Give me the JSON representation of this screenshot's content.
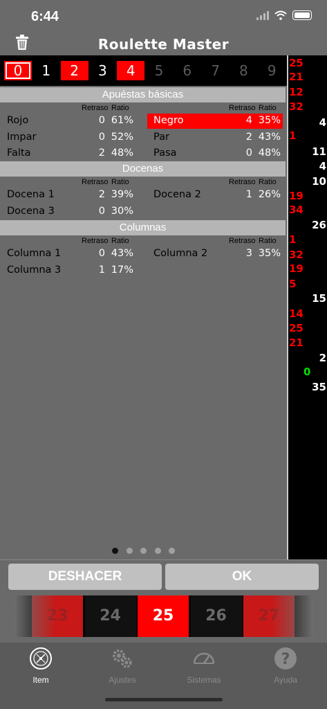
{
  "status": {
    "time": "6:44"
  },
  "header": {
    "title": "Roulette Master"
  },
  "strip": {
    "numbers": [
      {
        "n": "0",
        "style": "red-outline"
      },
      {
        "n": "1",
        "style": "white"
      },
      {
        "n": "2",
        "style": "red"
      },
      {
        "n": "3",
        "style": "white"
      },
      {
        "n": "4",
        "style": "red"
      },
      {
        "n": "5",
        "style": "dim"
      },
      {
        "n": "6",
        "style": "dim"
      },
      {
        "n": "7",
        "style": "dim"
      },
      {
        "n": "8",
        "style": "dim"
      },
      {
        "n": "9",
        "style": "dim"
      }
    ]
  },
  "history": [
    {
      "n": "25",
      "color": "red"
    },
    {
      "n": "21",
      "color": "red"
    },
    {
      "n": "12",
      "color": "red"
    },
    {
      "n": "32",
      "color": "red"
    },
    {
      "n": "4",
      "color": "white"
    },
    {
      "n": "1",
      "color": "red"
    },
    {
      "n": "11",
      "color": "white"
    },
    {
      "n": "4",
      "color": "white"
    },
    {
      "n": "10",
      "color": "white"
    },
    {
      "n": "19",
      "color": "red"
    },
    {
      "n": "34",
      "color": "red"
    },
    {
      "n": "26",
      "color": "white"
    },
    {
      "n": "1",
      "color": "red"
    },
    {
      "n": "32",
      "color": "red"
    },
    {
      "n": "19",
      "color": "red"
    },
    {
      "n": "5",
      "color": "red"
    },
    {
      "n": "15",
      "color": "white"
    },
    {
      "n": "14",
      "color": "red"
    },
    {
      "n": "25",
      "color": "red"
    },
    {
      "n": "21",
      "color": "red"
    },
    {
      "n": "2",
      "color": "white"
    },
    {
      "n": "0",
      "color": "green"
    },
    {
      "n": "35",
      "color": "white"
    }
  ],
  "sections": {
    "basic": {
      "title": "Apuéstas básicas",
      "hdr_delay": "Retraso",
      "hdr_ratio": "Ratio",
      "rows": [
        {
          "l_name": "Rojo",
          "l_delay": "0",
          "l_ratio": "61%",
          "r_name": "Negro",
          "r_delay": "4",
          "r_ratio": "35%"
        },
        {
          "l_name": "Impar",
          "l_delay": "0",
          "l_ratio": "52%",
          "r_name": "Par",
          "r_delay": "2",
          "r_ratio": "43%"
        },
        {
          "l_name": "Falta",
          "l_delay": "2",
          "l_ratio": "48%",
          "r_name": "Pasa",
          "r_delay": "0",
          "r_ratio": "48%"
        }
      ]
    },
    "dozens": {
      "title": "Docenas",
      "hdr_delay": "Retraso",
      "hdr_ratio": "Ratio",
      "rows": [
        {
          "l_name": "Docena 1",
          "l_delay": "2",
          "l_ratio": "39%",
          "r_name": "Docena 2",
          "r_delay": "1",
          "r_ratio": "26%"
        },
        {
          "l_name": "Docena 3",
          "l_delay": "0",
          "l_ratio": "30%"
        }
      ]
    },
    "columns": {
      "title": "Columnas",
      "hdr_delay": "Retraso",
      "hdr_ratio": "Ratio",
      "rows": [
        {
          "l_name": "Columna 1",
          "l_delay": "0",
          "l_ratio": "43%",
          "r_name": "Columna 2",
          "r_delay": "3",
          "r_ratio": "35%"
        },
        {
          "l_name": "Columna 3",
          "l_delay": "1",
          "l_ratio": "17%"
        }
      ]
    }
  },
  "pager": {
    "count": 5,
    "active": 0
  },
  "buttons": {
    "undo": "DESHACER",
    "ok": "OK"
  },
  "wheel": [
    {
      "n": "23",
      "color": "red"
    },
    {
      "n": "24",
      "color": "black"
    },
    {
      "n": "25",
      "color": "red-selected"
    },
    {
      "n": "26",
      "color": "black"
    },
    {
      "n": "27",
      "color": "red"
    }
  ],
  "tabs": [
    {
      "label": "Item",
      "icon": "roulette-icon",
      "active": true
    },
    {
      "label": "Ajustes",
      "icon": "gears-icon",
      "active": false
    },
    {
      "label": "Sistemas",
      "icon": "gauge-icon",
      "active": false
    },
    {
      "label": "Ayuda",
      "icon": "help-icon",
      "active": false
    }
  ],
  "colors": {
    "red": "#ff0000",
    "bg": "#6a6a6a",
    "green": "#00e000",
    "dim": "#7a7a7a"
  }
}
